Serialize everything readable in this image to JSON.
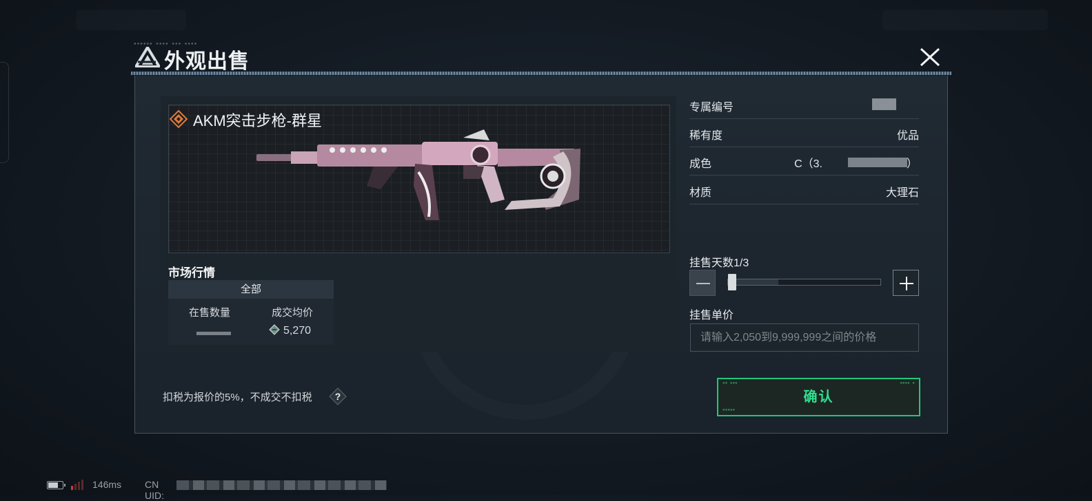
{
  "modal": {
    "title": "外观出售",
    "close_icon": "close-x-icon"
  },
  "item": {
    "name": "AKM突击步枪-群星",
    "rarity_icon": "rarity-diamond-icon",
    "rarity_color": "#e07b3a"
  },
  "market": {
    "title": "市场行情",
    "tab_label": "全部",
    "col_quantity": "在售数量",
    "col_avg_price": "成交均价",
    "avg_price": "5,270",
    "currency_icon": "coupon-currency-icon"
  },
  "properties": [
    {
      "label": "专属编号",
      "value": ""
    },
    {
      "label": "稀有度",
      "value": "优品"
    },
    {
      "label": "成色",
      "value_prefix": "C（3.",
      "value_suffix": "）"
    },
    {
      "label": "材质",
      "value": "大理石"
    }
  ],
  "listing": {
    "days_label": "挂售天数1/3",
    "days_current": 1,
    "days_max": 3,
    "price_label": "挂售单价",
    "price_placeholder": "请输入2,050到9,999,999之间的价格"
  },
  "footer": {
    "tax_note": "扣税为报价的5%，不成交不扣税",
    "help_glyph": "?",
    "confirm_label": "确认"
  },
  "status_bar": {
    "ping": "146ms",
    "uid_label": "CN UID:"
  },
  "colors": {
    "accent_green": "#23c77c",
    "background": "#131a22"
  }
}
